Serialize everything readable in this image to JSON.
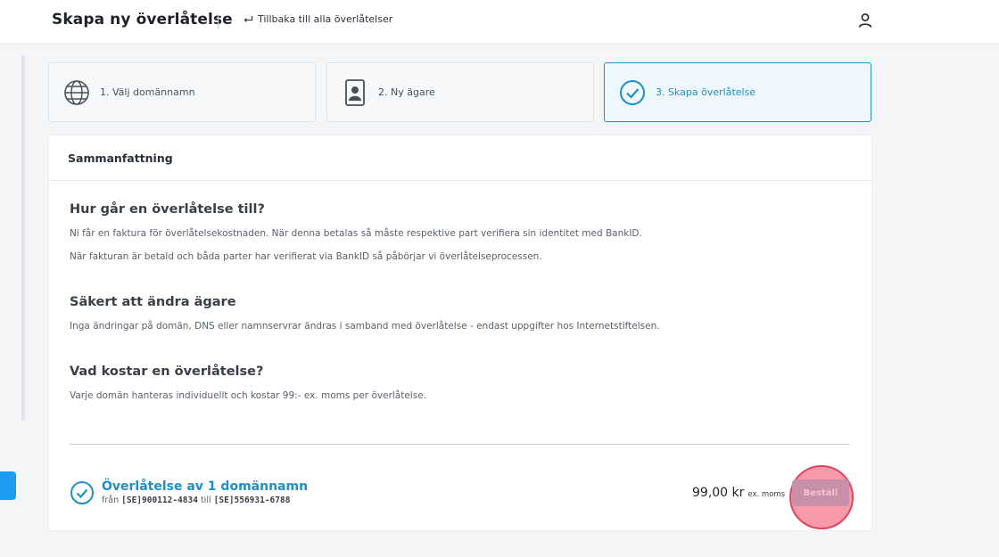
{
  "header": {
    "title": "Skapa ny överlåtelse",
    "back_label": "Tillbaka till alla överlåtelser",
    "icons": {
      "back": "return-arrow-icon",
      "user": "user-icon"
    }
  },
  "steps": [
    {
      "label": "1. Välj domännamn",
      "icon": "globe-icon",
      "active": false
    },
    {
      "label": "2. Ny ägare",
      "icon": "id-card-icon",
      "active": false
    },
    {
      "label": "3. Skapa överlåtelse",
      "icon": "check-circle-icon",
      "active": true
    }
  ],
  "summary": {
    "title": "Sammanfattning",
    "sections": [
      {
        "heading": "Hur går en överlåtelse till?",
        "paragraphs": [
          "Ni får en faktura för överlåtelsekostnaden. När denna betalas så måste respektive part verifiera sin identitet med BankID.",
          "När fakturan är betald och båda parter har verifierat via BankID så påbörjar vi överlåtelseprocessen."
        ]
      },
      {
        "heading": "Säkert att ändra ägare",
        "paragraphs": [
          "Inga ändringar på domän, DNS eller namnservrar ändras i samband med överlåtelse - endast uppgifter hos Internetstiftelsen."
        ]
      },
      {
        "heading": "Vad kostar en överlåtelse?",
        "paragraphs": [
          "Varje domän hanteras individuellt och kostar 99:- ex. moms per överlåtelse."
        ]
      }
    ]
  },
  "order": {
    "title": "Överlåtelse av 1 domännamn",
    "from_label": "från",
    "from_id": "[SE]900112-4834",
    "to_label": "till",
    "to_id": "[SE]556931-6788",
    "price": "99,00 kr",
    "vat_note": "ex. moms",
    "button_label": "Beställ"
  },
  "colors": {
    "accent": "#1f8fc4",
    "highlight_ring": "#e0455f",
    "button": "#c98fa8"
  }
}
